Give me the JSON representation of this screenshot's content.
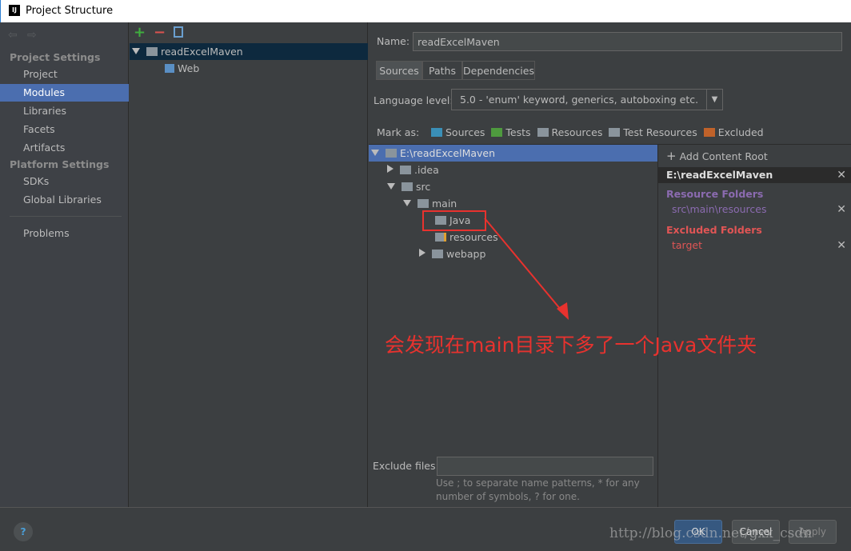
{
  "window": {
    "title": "Project Structure",
    "logo": "IJ"
  },
  "sidebar": {
    "project_settings": "Project Settings",
    "items": [
      "Project",
      "Modules",
      "Libraries",
      "Facets",
      "Artifacts"
    ],
    "platform_settings": "Platform Settings",
    "platform_items": [
      "SDKs",
      "Global Libraries"
    ],
    "problems": "Problems",
    "selected": "Modules"
  },
  "modules": {
    "toolbar": [
      "plus-icon",
      "minus-icon",
      "copy-icon"
    ],
    "tree": [
      {
        "label": "readExcelMaven"
      },
      {
        "label": "Web"
      }
    ]
  },
  "module": {
    "name_label": "Name:",
    "name_value": "readExcelMaven",
    "tabs": [
      "Sources",
      "Paths",
      "Dependencies"
    ],
    "active_tab": "Sources",
    "language_label": "Language level:",
    "language_value": "5.0 - 'enum' keyword, generics, autoboxing etc.",
    "mark_as": "Mark as:",
    "marks": [
      "Sources",
      "Tests",
      "Resources",
      "Test Resources",
      "Excluded"
    ]
  },
  "tree": [
    "E:\\readExcelMaven",
    ".idea",
    "src",
    "main",
    "Java",
    "resources",
    "webapp"
  ],
  "content_root": {
    "add": "Add Content Root",
    "root": "E:\\readExcelMaven",
    "resource_header": "Resource Folders",
    "resource_item": "src\\main\\resources",
    "excluded_header": "Excluded Folders",
    "excluded_item": "target"
  },
  "annotation": "会发现在main目录下多了一个Java文件夹",
  "exclude": {
    "label": "Exclude files:",
    "value": "",
    "hint1": "Use ; to separate name patterns, * for any",
    "hint2": "number of symbols, ? for one."
  },
  "footer": {
    "ok": "OK",
    "cancel": "Cancel",
    "apply": "Apply",
    "watermark": "http://blog.csdn.net/gxx_csdn"
  },
  "colors": {
    "selection": "#4b6eaf",
    "resource": "#8b6bb0",
    "excluded": "#e05555",
    "annotation": "#e8322e"
  }
}
